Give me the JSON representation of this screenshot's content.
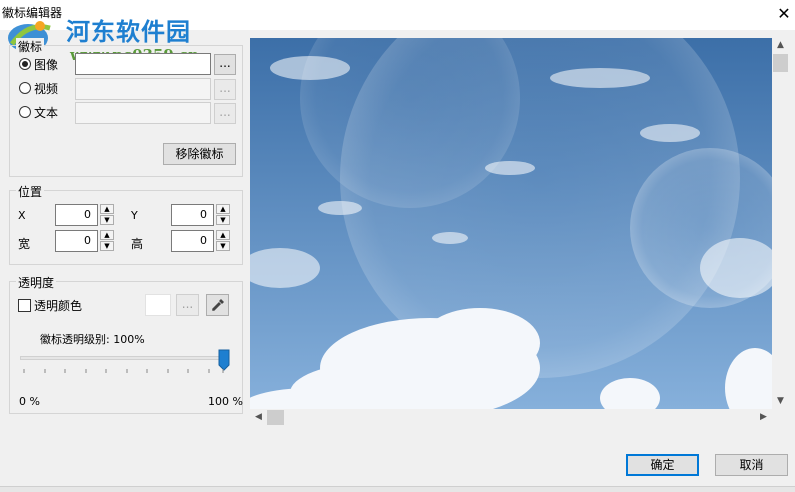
{
  "dialog": {
    "title": "徽标编辑器",
    "close_glyph": "✕"
  },
  "watermark": {
    "brand": "河东软件园",
    "url": "www.pc0359.cn"
  },
  "logo_group": {
    "label": "徽标",
    "options": [
      {
        "label": "图像",
        "selected": true
      },
      {
        "label": "视频",
        "selected": false
      },
      {
        "label": "文本",
        "selected": false
      }
    ],
    "browse_label": "...",
    "remove_label": "移除徽标"
  },
  "position_group": {
    "label": "位置",
    "x_label": "X",
    "y_label": "Y",
    "width_label": "宽",
    "height_label": "高",
    "x_value": "0",
    "y_value": "0",
    "width_value": "0",
    "height_value": "0"
  },
  "opacity_group": {
    "label": "透明度",
    "transparent_color_label": "透明颜色",
    "transparent_color_checked": false,
    "swatch_color": "#ffffff",
    "browse_label": "...",
    "level_label": "徽标透明级别: 100%",
    "level_value": 100,
    "min_label": "0 %",
    "max_label": "100 %"
  },
  "footer": {
    "ok_label": "确定",
    "cancel_label": "取消"
  },
  "colors": {
    "accent": "#0078d7",
    "slider_thumb": "#1e7fd0",
    "sky_top": "#3c6fa8",
    "sky_bottom": "#86b0db",
    "watermark_blue": "#1e7fd0",
    "watermark_green": "#5a9a3a"
  }
}
